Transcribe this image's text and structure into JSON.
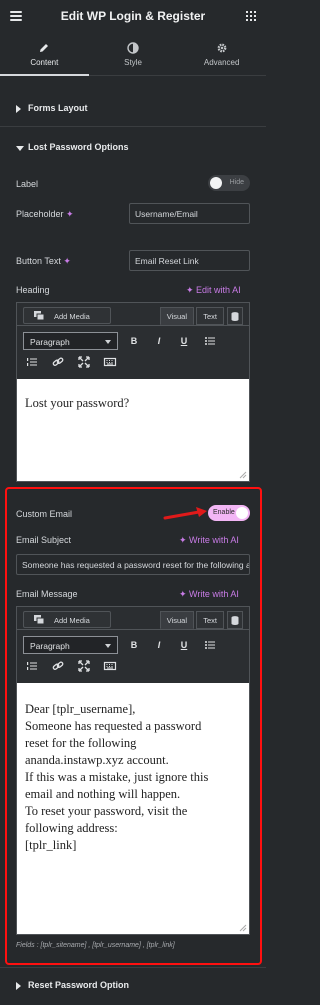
{
  "header": {
    "title": "Edit WP Login & Register"
  },
  "tabs": [
    {
      "label": "Content",
      "icon": "pencil-icon"
    },
    {
      "label": "Style",
      "icon": "contrast-icon"
    },
    {
      "label": "Advanced",
      "icon": "gear-icon"
    }
  ],
  "sections": {
    "forms_layout": "Forms Layout",
    "lost_password": "Lost Password Options",
    "reset_password": "Reset Password Option"
  },
  "lost_password": {
    "label_label": "Label",
    "label_toggle": "Hide",
    "placeholder_label": "Placeholder",
    "placeholder_value": "Username/Email",
    "button_text_label": "Button Text",
    "button_text_value": "Email Reset Link",
    "heading_label": "Heading",
    "write_ai": "Write with AI",
    "edit_ai": "Edit with AI",
    "heading_content": "Lost your password?"
  },
  "editor": {
    "add_media": "Add Media",
    "visual": "Visual",
    "text": "Text",
    "paragraph": "Paragraph",
    "bold": "B",
    "italic": "I",
    "underline": "U"
  },
  "custom_email": {
    "label": "Custom Email",
    "toggle": "Enable",
    "subject_label": "Email Subject",
    "subject_value": "Someone has requested a password reset for the following account",
    "message_label": "Email Message",
    "message_lines": [
      "Dear [tplr_username],",
      "Someone has requested a password",
      "reset for the following",
      "ananda.instawp.xyz account.",
      "If this was a mistake, just ignore this",
      "email and nothing will happen.",
      "To reset your password, visit the",
      "following address:",
      "[tplr_link]"
    ],
    "fields_note": "Fields : [tplr_sitename] , [tplr_username] , [tplr_link]"
  },
  "colors": {
    "accent_ai": "#c97ce7",
    "toggle_on": "#f2b6f5",
    "highlight_box": "#ff1010",
    "arrow": "#e01a1a"
  }
}
